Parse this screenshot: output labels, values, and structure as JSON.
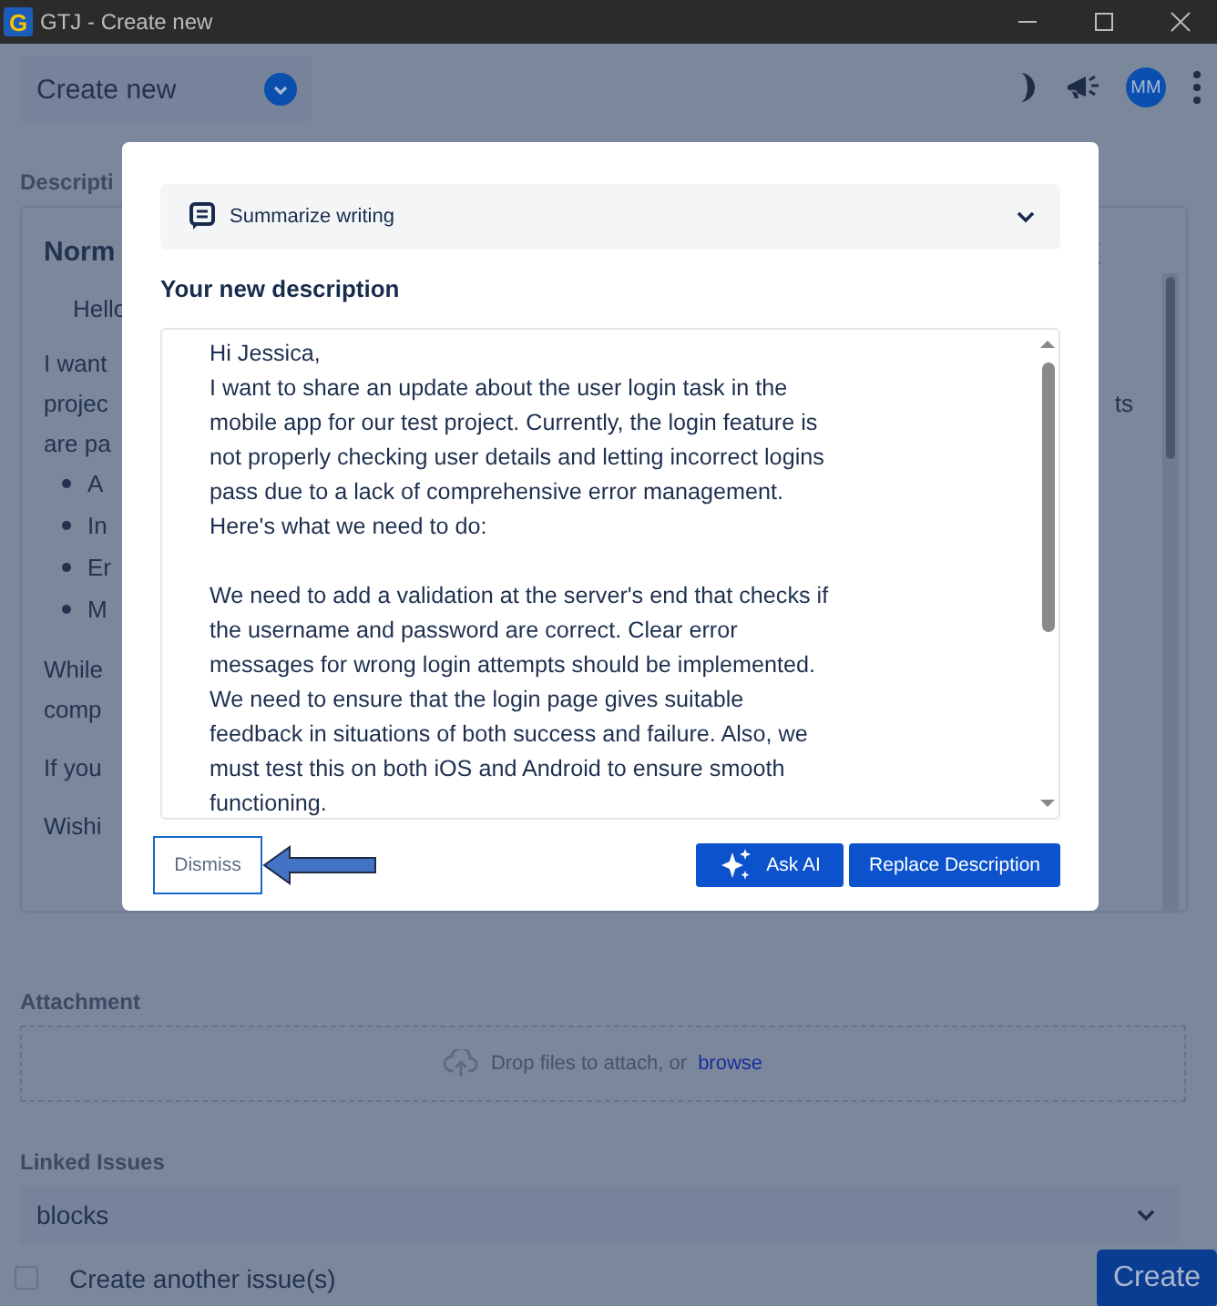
{
  "window": {
    "title": "GTJ - Create new",
    "logo": "G"
  },
  "header": {
    "title": "Create new",
    "avatar": "MM"
  },
  "description": {
    "label": "Descripti",
    "style": "Norm",
    "lines": [
      {
        "left": "Hello",
        "kind": "text"
      },
      {
        "left": "I want",
        "kind": "text"
      },
      {
        "left": "projec",
        "right": "ts",
        "kind": "text"
      },
      {
        "left": "are pa",
        "kind": "text"
      },
      {
        "left": "A",
        "kind": "bullet"
      },
      {
        "left": "In",
        "kind": "bullet"
      },
      {
        "left": "Er",
        "kind": "bullet"
      },
      {
        "left": "M",
        "kind": "bullet"
      },
      {
        "left": "While",
        "kind": "text"
      },
      {
        "left": "comp",
        "kind": "text"
      },
      {
        "left": "If you",
        "kind": "text"
      },
      {
        "left": "Wishi",
        "kind": "text"
      }
    ]
  },
  "attachment": {
    "label": "Attachment",
    "hint": "Drop files to attach, or",
    "link": "browse"
  },
  "linked_issues": {
    "label": "Linked Issues",
    "value": "blocks"
  },
  "footer": {
    "checkbox": {
      "label": "Create another issue(s)",
      "checked": false
    },
    "button": "Create"
  },
  "modal": {
    "mode": "Summarize writing",
    "heading": "Your new description",
    "paragraphs": [
      "Hi Jessica,\nI want to share an update about the user login task in the mobile app for our test project. Currently, the login feature is not properly checking user details and letting incorrect logins pass due to a lack of comprehensive error management. Here's what we need to do:",
      "We need to add a validation at the server's end that checks if the username and password are correct. Clear error messages for wrong login attempts should be implemented. We need to ensure that the login page gives suitable feedback in situations of both success and failure. Also, we must test this on both iOS and Android to ensure smooth functioning."
    ],
    "buttons": {
      "dismiss": "Dismiss",
      "ask": "Ask AI",
      "replace": "Replace Description"
    }
  }
}
